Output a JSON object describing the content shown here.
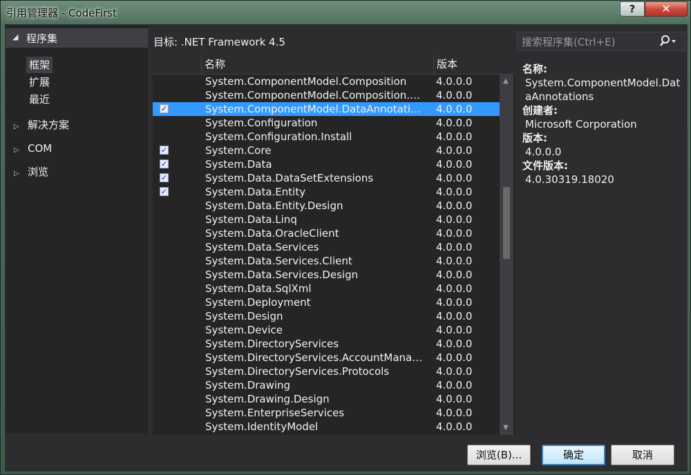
{
  "window": {
    "title": "引用管理器 - CodeFirst",
    "help_label": "?",
    "close_label": "✕"
  },
  "nav": {
    "header": "程序集",
    "sub_items": [
      "框架",
      "扩展",
      "最近"
    ],
    "groups": [
      "解决方案",
      "COM",
      "浏览"
    ]
  },
  "target": "目标: .NET Framework 4.5",
  "search": {
    "placeholder": "搜索程序集(Ctrl+E)"
  },
  "list": {
    "columns": {
      "name": "名称",
      "version": "版本"
    },
    "rows": [
      {
        "name": "System.ComponentModel.Composition",
        "version": "4.0.0.0",
        "checked": false,
        "selected": false
      },
      {
        "name": "System.ComponentModel.Composition.R...",
        "version": "4.0.0.0",
        "checked": false,
        "selected": false
      },
      {
        "name": "System.ComponentModel.DataAnnotations",
        "version": "4.0.0.0",
        "checked": true,
        "selected": true
      },
      {
        "name": "System.Configuration",
        "version": "4.0.0.0",
        "checked": false,
        "selected": false
      },
      {
        "name": "System.Configuration.Install",
        "version": "4.0.0.0",
        "checked": false,
        "selected": false
      },
      {
        "name": "System.Core",
        "version": "4.0.0.0",
        "checked": true,
        "selected": false
      },
      {
        "name": "System.Data",
        "version": "4.0.0.0",
        "checked": true,
        "selected": false
      },
      {
        "name": "System.Data.DataSetExtensions",
        "version": "4.0.0.0",
        "checked": true,
        "selected": false
      },
      {
        "name": "System.Data.Entity",
        "version": "4.0.0.0",
        "checked": true,
        "selected": false
      },
      {
        "name": "System.Data.Entity.Design",
        "version": "4.0.0.0",
        "checked": false,
        "selected": false
      },
      {
        "name": "System.Data.Linq",
        "version": "4.0.0.0",
        "checked": false,
        "selected": false
      },
      {
        "name": "System.Data.OracleClient",
        "version": "4.0.0.0",
        "checked": false,
        "selected": false
      },
      {
        "name": "System.Data.Services",
        "version": "4.0.0.0",
        "checked": false,
        "selected": false
      },
      {
        "name": "System.Data.Services.Client",
        "version": "4.0.0.0",
        "checked": false,
        "selected": false
      },
      {
        "name": "System.Data.Services.Design",
        "version": "4.0.0.0",
        "checked": false,
        "selected": false
      },
      {
        "name": "System.Data.SqlXml",
        "version": "4.0.0.0",
        "checked": false,
        "selected": false
      },
      {
        "name": "System.Deployment",
        "version": "4.0.0.0",
        "checked": false,
        "selected": false
      },
      {
        "name": "System.Design",
        "version": "4.0.0.0",
        "checked": false,
        "selected": false
      },
      {
        "name": "System.Device",
        "version": "4.0.0.0",
        "checked": false,
        "selected": false
      },
      {
        "name": "System.DirectoryServices",
        "version": "4.0.0.0",
        "checked": false,
        "selected": false
      },
      {
        "name": "System.DirectoryServices.AccountManag...",
        "version": "4.0.0.0",
        "checked": false,
        "selected": false
      },
      {
        "name": "System.DirectoryServices.Protocols",
        "version": "4.0.0.0",
        "checked": false,
        "selected": false
      },
      {
        "name": "System.Drawing",
        "version": "4.0.0.0",
        "checked": false,
        "selected": false
      },
      {
        "name": "System.Drawing.Design",
        "version": "4.0.0.0",
        "checked": false,
        "selected": false
      },
      {
        "name": "System.EnterpriseServices",
        "version": "4.0.0.0",
        "checked": false,
        "selected": false
      },
      {
        "name": "System.IdentityModel",
        "version": "4.0.0.0",
        "checked": false,
        "selected": false
      }
    ]
  },
  "details": {
    "name_label": "名称:",
    "name_value": "System.ComponentModel.DataAnnotations",
    "creator_label": "创建者:",
    "creator_value": "Microsoft Corporation",
    "version_label": "版本:",
    "version_value": "4.0.0.0",
    "file_version_label": "文件版本:",
    "file_version_value": "4.0.30319.18020"
  },
  "buttons": {
    "browse": "浏览(B)...",
    "ok": "确定",
    "cancel": "取消"
  }
}
